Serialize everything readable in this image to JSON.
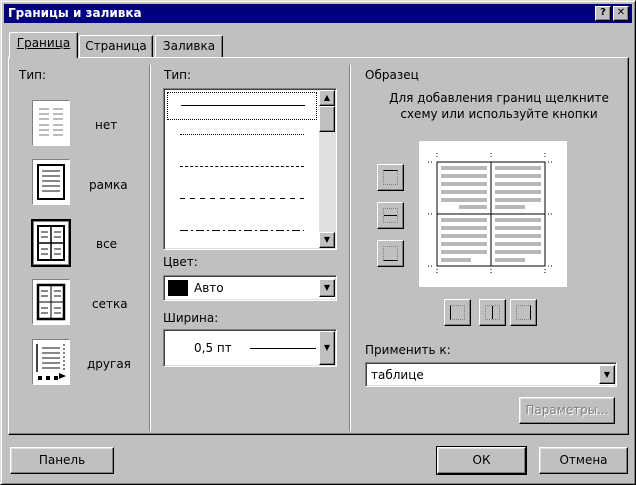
{
  "window": {
    "title": "Границы и заливка",
    "help_label": "?",
    "close_label": "✕"
  },
  "tabs": [
    {
      "label": "Граница",
      "active": true
    },
    {
      "label": "Страница",
      "active": false
    },
    {
      "label": "Заливка",
      "active": false
    }
  ],
  "settings": {
    "heading": "Тип:",
    "items": [
      {
        "label": "нет"
      },
      {
        "label": "рамка"
      },
      {
        "label": "все",
        "selected": true
      },
      {
        "label": "сетка"
      },
      {
        "label": "другая"
      }
    ]
  },
  "style": {
    "heading": "Тип:",
    "line_styles": [
      "solid",
      "dotted",
      "dashed-fine",
      "dashed",
      "dash-dot"
    ],
    "color_label": "Цвет:",
    "color_value": "Авто",
    "color_swatch": "#000000",
    "width_label": "Ширина:",
    "width_value": "0,5 пт"
  },
  "preview": {
    "heading": "Образец",
    "hint": "Для добавления границ щелкните схему или используйте кнопки",
    "apply_label": "Применить к:",
    "apply_value": "таблице",
    "options_label": "Параметры..."
  },
  "footer": {
    "panel_label": "Панель",
    "ok_label": "ОК",
    "cancel_label": "Отмена"
  }
}
